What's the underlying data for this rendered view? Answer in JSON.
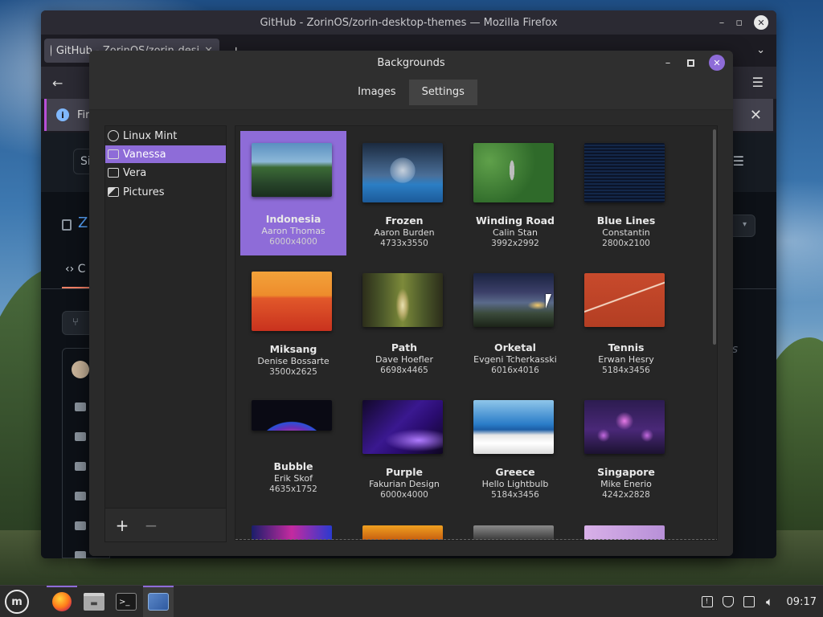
{
  "firefox": {
    "window_title": "GitHub - ZorinOS/zorin-desktop-themes — Mozilla Firefox",
    "tab_label": "GitHub - ZorinOS/zorin-desi",
    "tab_close": "✕",
    "new_tab": "+",
    "infobar_text": "Fir",
    "search_text": "Si",
    "repo_initial": "Z",
    "code_tab_initial": "C",
    "side_text": "s"
  },
  "backgrounds": {
    "title": "Backgrounds",
    "tabs": [
      {
        "label": "Images",
        "active": false
      },
      {
        "label": "Settings",
        "active": true
      }
    ],
    "sidebar_items": [
      {
        "label": "Linux Mint",
        "icon": "linux-mint-icon"
      },
      {
        "label": "Vanessa",
        "icon": "monitor-icon",
        "selected": true
      },
      {
        "label": "Vera",
        "icon": "monitor-icon"
      },
      {
        "label": "Pictures",
        "icon": "picture-icon"
      }
    ],
    "add_label": "+",
    "remove_label": "−",
    "wallpapers": [
      {
        "name": "Indonesia",
        "author": "Aaron Thomas",
        "size": "6000x4000",
        "selected": true
      },
      {
        "name": "Frozen",
        "author": "Aaron Burden",
        "size": "4733x3550"
      },
      {
        "name": "Winding Road",
        "author": "Calin Stan",
        "size": "3992x2992"
      },
      {
        "name": "Blue Lines",
        "author": "Constantin",
        "size": "2800x2100"
      },
      {
        "name": "Miksang",
        "author": "Denise Bossarte",
        "size": "3500x2625"
      },
      {
        "name": "Path",
        "author": "Dave Hoefler",
        "size": "6698x4465"
      },
      {
        "name": "Orketal",
        "author": "Evgeni Tcherkasski",
        "size": "6016x4016"
      },
      {
        "name": "Tennis",
        "author": "Erwan Hesry",
        "size": "5184x3456"
      },
      {
        "name": "Bubble",
        "author": "Erik Skof",
        "size": "4635x1752"
      },
      {
        "name": "Purple",
        "author": "Fakurian Design",
        "size": "6000x4000"
      },
      {
        "name": "Greece",
        "author": "Hello Lightbulb",
        "size": "5184x3456"
      },
      {
        "name": "Singapore",
        "author": "Mike Enerio",
        "size": "4242x2828"
      }
    ]
  },
  "taskbar": {
    "menu_icon": "linux-mint-menu-icon",
    "apps": [
      "firefox-icon",
      "files-icon",
      "terminal-icon",
      "backgrounds-app-icon"
    ],
    "time": "09:17"
  },
  "colors": {
    "accent": "#8e6cd8",
    "window_bg": "#2f2f2f",
    "taskbar_bg": "#2b2b2b"
  }
}
